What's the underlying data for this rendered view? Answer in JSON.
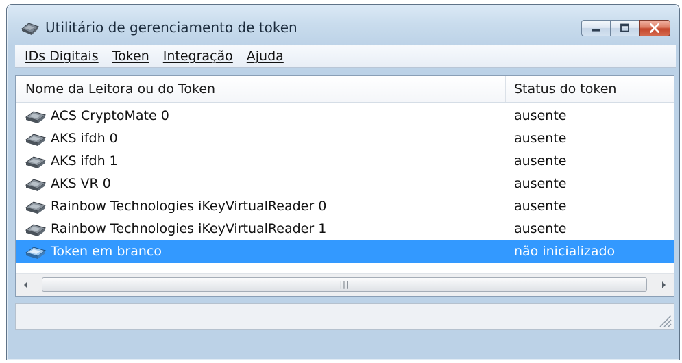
{
  "window": {
    "title": "Utilitário de gerenciamento de token",
    "icon": "token-utility-icon",
    "caption_buttons": [
      "minimize-icon",
      "maximize-icon",
      "close-icon"
    ]
  },
  "menu": {
    "items": [
      {
        "label": "IDs Digitais"
      },
      {
        "label": "Token"
      },
      {
        "label": "Integração"
      },
      {
        "label": "Ajuda"
      }
    ]
  },
  "list": {
    "columns": {
      "name": "Nome da Leitora ou do Token",
      "status": "Status do token"
    },
    "rows": [
      {
        "name": "ACS CryptoMate 0",
        "status": "ausente",
        "icon": "reader-icon",
        "selected": false
      },
      {
        "name": "AKS ifdh 0",
        "status": "ausente",
        "icon": "reader-icon",
        "selected": false
      },
      {
        "name": "AKS ifdh 1",
        "status": "ausente",
        "icon": "reader-icon",
        "selected": false
      },
      {
        "name": "AKS VR 0",
        "status": "ausente",
        "icon": "reader-icon",
        "selected": false
      },
      {
        "name": "Rainbow Technologies iKeyVirtualReader 0",
        "status": "ausente",
        "icon": "reader-icon",
        "selected": false
      },
      {
        "name": "Rainbow Technologies iKeyVirtualReader 1",
        "status": "ausente",
        "icon": "reader-icon",
        "selected": false
      },
      {
        "name": "Token em branco",
        "status": "não inicializado",
        "icon": "token-icon",
        "selected": true
      }
    ],
    "selection_color": "#3399ff"
  }
}
